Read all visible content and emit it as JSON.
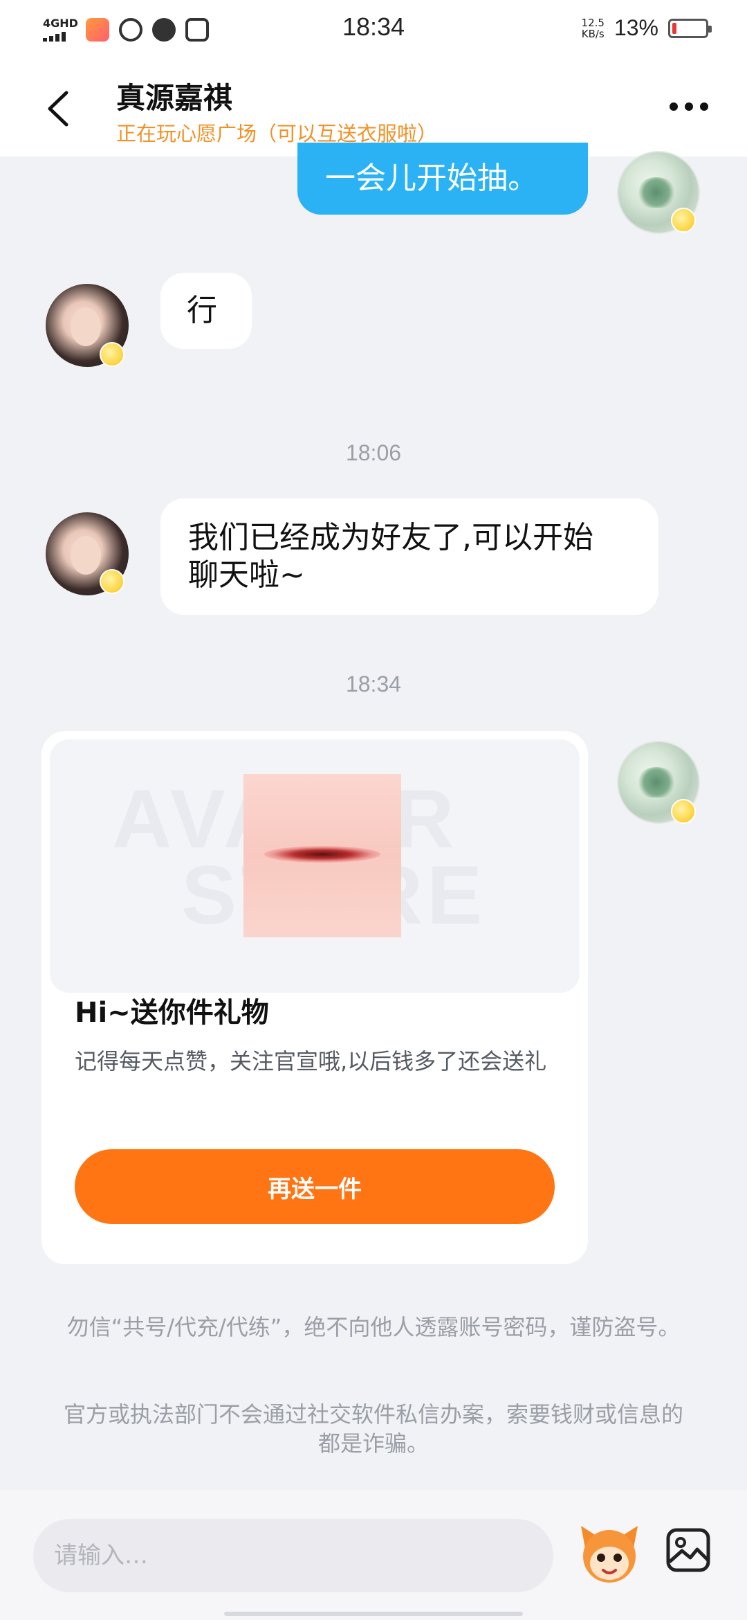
{
  "status_bar": {
    "network": "4GHD",
    "time": "18:34",
    "speed_value": "12.5",
    "speed_unit": "KB/s",
    "battery_percent": "13%",
    "battery_level": 0.13,
    "battery_color": "#e53935",
    "app_icons": [
      "video-app-icon",
      "circle-app-icon",
      "chat-app-icon",
      "qq-app-icon"
    ]
  },
  "header": {
    "title": "真源嘉祺",
    "subtitle": "正在玩心愿广场（可以互送衣服啦）",
    "subtitle_color": "#f29127",
    "back_icon": "chevron-left-icon",
    "more_icon": "more-dots-icon"
  },
  "messages": [
    {
      "sender": "me",
      "text": "一会儿开始抽。"
    },
    {
      "sender": "friend",
      "text": "行"
    },
    {
      "type": "timestamp",
      "text": "18:06"
    },
    {
      "sender": "friend",
      "text_line1": "我们已经成为好友了,可以开始",
      "text_line2": "聊天啦~"
    },
    {
      "type": "timestamp",
      "text": "18:34"
    }
  ],
  "gift_card": {
    "watermark_line1": "AVATAR",
    "watermark_line2": "STORE",
    "title": "Hi~送你件礼物",
    "description": "记得每天点赞，关注官宣哦,以后钱多了还会送礼",
    "button_label": "再送一件",
    "button_color": "#ff7413"
  },
  "notices": {
    "line1": "勿信“共号/代充/代练”，绝不向他人透露账号密码，谨防盗号。",
    "line2": "官方或执法部门不会通过社交软件私信办案，索要钱财或信息的都是诈骗。"
  },
  "input": {
    "placeholder": "请输入…",
    "emoji_icon": "mascot-face-icon",
    "image_icon": "image-picture-icon"
  },
  "colors": {
    "my_bubble": "#2ab2f5",
    "their_bubble": "#ffffff",
    "background": "#f1f2f6"
  }
}
